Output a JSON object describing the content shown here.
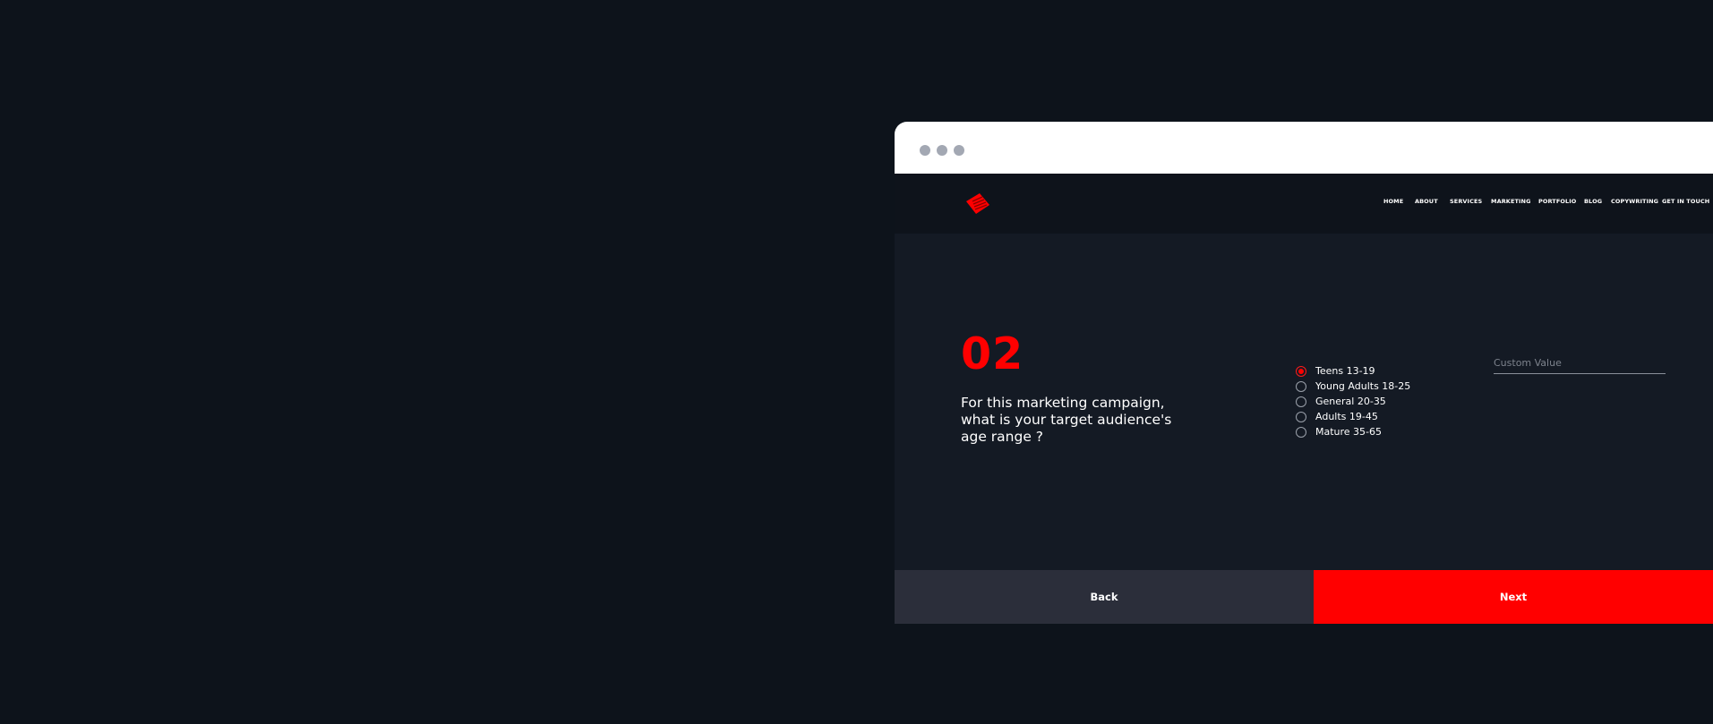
{
  "colors": {
    "page_background": "#0d131b",
    "accent": "#ff0000",
    "back_button": "#2b2e3a",
    "titlebar": "#ffffff"
  },
  "window": {
    "controls": [
      "window-dot",
      "window-dot",
      "window-dot"
    ]
  },
  "nav": {
    "logo_icon": "red-diamond-logo-icon",
    "items": [
      {
        "label": "HOME"
      },
      {
        "label": "ABOUT"
      },
      {
        "label": "SERVICES"
      },
      {
        "label": "MARKETING"
      },
      {
        "label": "PORTFOLIO"
      },
      {
        "label": "BLOG"
      },
      {
        "label": "COPYWRITING"
      },
      {
        "label": "GET IN TOUCH"
      }
    ]
  },
  "question": {
    "number": "02",
    "text": "For this marketing campaign, what is your target audience's age range ?"
  },
  "options": [
    {
      "label": "Teens 13-19",
      "checked": true
    },
    {
      "label": "Young Adults 18-25",
      "checked": false
    },
    {
      "label": "General 20-35",
      "checked": false
    },
    {
      "label": "Adults 19-45",
      "checked": false
    },
    {
      "label": "Mature 35-65",
      "checked": false
    }
  ],
  "custom": {
    "placeholder": "Custom Value",
    "value": ""
  },
  "footer": {
    "back_label": "Back",
    "next_label": "Next"
  }
}
